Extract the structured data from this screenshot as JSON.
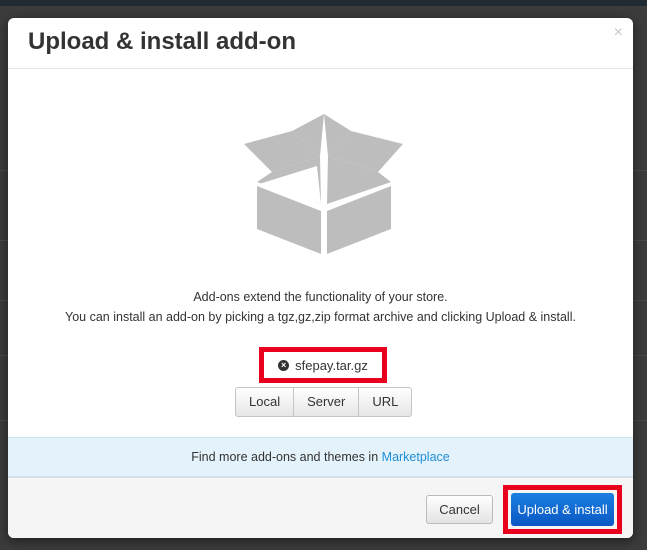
{
  "dialog": {
    "title": "Upload & install add-on",
    "close_glyph": "×"
  },
  "description": {
    "line1": "Add-ons extend the functionality of your store.",
    "line2": "You can install an add-on by picking a tgz,gz,zip format archive and clicking Upload & install."
  },
  "selected_file": {
    "name": "sfepay.tar.gz",
    "remove_glyph": "×"
  },
  "sources": [
    {
      "label": "Local"
    },
    {
      "label": "Server"
    },
    {
      "label": "URL"
    }
  ],
  "marketplace": {
    "text": "Find more add-ons and themes in",
    "link": "Marketplace"
  },
  "footer": {
    "cancel_label": "Cancel",
    "install_label": "Upload & install"
  },
  "colors": {
    "highlight": "#e8001c",
    "primary": "#0b58c4",
    "link": "#1f8dd6",
    "info_bg": "#e4f3fb",
    "box_icon": "#bdbdbd"
  },
  "icons": {
    "close": "close-icon",
    "remove_file": "remove-file-icon",
    "illustration": "open-box-icon"
  }
}
